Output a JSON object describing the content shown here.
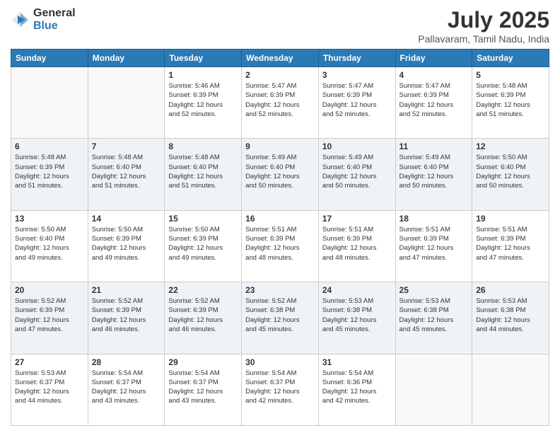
{
  "header": {
    "logo_general": "General",
    "logo_blue": "Blue",
    "title": "July 2025",
    "subtitle": "Pallavaram, Tamil Nadu, India"
  },
  "days_of_week": [
    "Sunday",
    "Monday",
    "Tuesday",
    "Wednesday",
    "Thursday",
    "Friday",
    "Saturday"
  ],
  "weeks": [
    [
      {
        "day": "",
        "info": ""
      },
      {
        "day": "",
        "info": ""
      },
      {
        "day": "1",
        "sunrise": "5:46 AM",
        "sunset": "6:39 PM",
        "daylight": "12 hours and 52 minutes."
      },
      {
        "day": "2",
        "sunrise": "5:47 AM",
        "sunset": "6:39 PM",
        "daylight": "12 hours and 52 minutes."
      },
      {
        "day": "3",
        "sunrise": "5:47 AM",
        "sunset": "6:39 PM",
        "daylight": "12 hours and 52 minutes."
      },
      {
        "day": "4",
        "sunrise": "5:47 AM",
        "sunset": "6:39 PM",
        "daylight": "12 hours and 52 minutes."
      },
      {
        "day": "5",
        "sunrise": "5:48 AM",
        "sunset": "6:39 PM",
        "daylight": "12 hours and 51 minutes."
      }
    ],
    [
      {
        "day": "6",
        "sunrise": "5:48 AM",
        "sunset": "6:39 PM",
        "daylight": "12 hours and 51 minutes."
      },
      {
        "day": "7",
        "sunrise": "5:48 AM",
        "sunset": "6:40 PM",
        "daylight": "12 hours and 51 minutes."
      },
      {
        "day": "8",
        "sunrise": "5:48 AM",
        "sunset": "6:40 PM",
        "daylight": "12 hours and 51 minutes."
      },
      {
        "day": "9",
        "sunrise": "5:49 AM",
        "sunset": "6:40 PM",
        "daylight": "12 hours and 50 minutes."
      },
      {
        "day": "10",
        "sunrise": "5:49 AM",
        "sunset": "6:40 PM",
        "daylight": "12 hours and 50 minutes."
      },
      {
        "day": "11",
        "sunrise": "5:49 AM",
        "sunset": "6:40 PM",
        "daylight": "12 hours and 50 minutes."
      },
      {
        "day": "12",
        "sunrise": "5:50 AM",
        "sunset": "6:40 PM",
        "daylight": "12 hours and 50 minutes."
      }
    ],
    [
      {
        "day": "13",
        "sunrise": "5:50 AM",
        "sunset": "6:40 PM",
        "daylight": "12 hours and 49 minutes."
      },
      {
        "day": "14",
        "sunrise": "5:50 AM",
        "sunset": "6:39 PM",
        "daylight": "12 hours and 49 minutes."
      },
      {
        "day": "15",
        "sunrise": "5:50 AM",
        "sunset": "6:39 PM",
        "daylight": "12 hours and 49 minutes."
      },
      {
        "day": "16",
        "sunrise": "5:51 AM",
        "sunset": "6:39 PM",
        "daylight": "12 hours and 48 minutes."
      },
      {
        "day": "17",
        "sunrise": "5:51 AM",
        "sunset": "6:39 PM",
        "daylight": "12 hours and 48 minutes."
      },
      {
        "day": "18",
        "sunrise": "5:51 AM",
        "sunset": "6:39 PM",
        "daylight": "12 hours and 47 minutes."
      },
      {
        "day": "19",
        "sunrise": "5:51 AM",
        "sunset": "6:39 PM",
        "daylight": "12 hours and 47 minutes."
      }
    ],
    [
      {
        "day": "20",
        "sunrise": "5:52 AM",
        "sunset": "6:39 PM",
        "daylight": "12 hours and 47 minutes."
      },
      {
        "day": "21",
        "sunrise": "5:52 AM",
        "sunset": "6:39 PM",
        "daylight": "12 hours and 46 minutes."
      },
      {
        "day": "22",
        "sunrise": "5:52 AM",
        "sunset": "6:39 PM",
        "daylight": "12 hours and 46 minutes."
      },
      {
        "day": "23",
        "sunrise": "5:52 AM",
        "sunset": "6:38 PM",
        "daylight": "12 hours and 45 minutes."
      },
      {
        "day": "24",
        "sunrise": "5:53 AM",
        "sunset": "6:38 PM",
        "daylight": "12 hours and 45 minutes."
      },
      {
        "day": "25",
        "sunrise": "5:53 AM",
        "sunset": "6:38 PM",
        "daylight": "12 hours and 45 minutes."
      },
      {
        "day": "26",
        "sunrise": "5:53 AM",
        "sunset": "6:38 PM",
        "daylight": "12 hours and 44 minutes."
      }
    ],
    [
      {
        "day": "27",
        "sunrise": "5:53 AM",
        "sunset": "6:37 PM",
        "daylight": "12 hours and 44 minutes."
      },
      {
        "day": "28",
        "sunrise": "5:54 AM",
        "sunset": "6:37 PM",
        "daylight": "12 hours and 43 minutes."
      },
      {
        "day": "29",
        "sunrise": "5:54 AM",
        "sunset": "6:37 PM",
        "daylight": "12 hours and 43 minutes."
      },
      {
        "day": "30",
        "sunrise": "5:54 AM",
        "sunset": "6:37 PM",
        "daylight": "12 hours and 42 minutes."
      },
      {
        "day": "31",
        "sunrise": "5:54 AM",
        "sunset": "6:36 PM",
        "daylight": "12 hours and 42 minutes."
      },
      {
        "day": "",
        "info": ""
      },
      {
        "day": "",
        "info": ""
      }
    ]
  ]
}
